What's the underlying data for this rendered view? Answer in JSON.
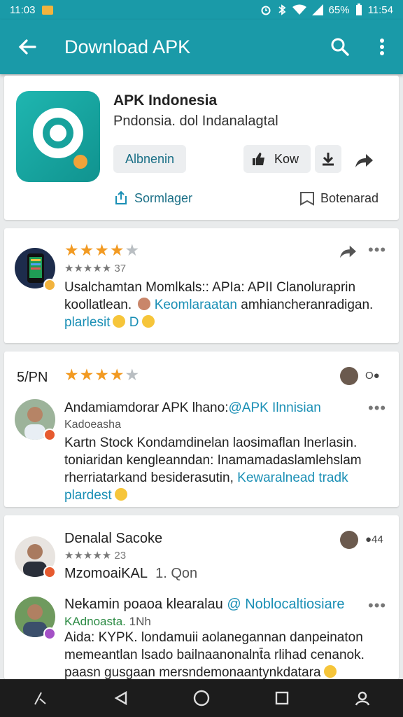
{
  "status_bar": {
    "time": "11:03",
    "battery": "65%",
    "time_right": "11:54",
    "icons": [
      "alarm-icon",
      "bluetooth-icon",
      "wifi-icon",
      "signal-icon",
      "battery-icon"
    ]
  },
  "app_bar": {
    "title": "Download APK",
    "color": "#1a9aa8"
  },
  "app_card": {
    "name": "APK Indonesia",
    "subtitle": "Pndonsia. dol Indanalagtal",
    "primary_button": "Albnenin",
    "like_button": "Kow",
    "left_link": "Sormlager",
    "right_link": "Botenarad"
  },
  "reviews": [
    {
      "stars": 4,
      "date": "★★★★★ 37",
      "text_line1": "Usalchamtan Momlkals:: APIa: APII Clanoluraprin",
      "text_line2_a": "koollatlean.",
      "text_line2_b": "Keomlaraatan",
      "text_line2_c": "amhiancheranradigan.",
      "text_line3": "plarlesit",
      "text_line3_b": "D"
    },
    {
      "header_label": "5/PN",
      "stars": 4,
      "author": "Andamiamdorar APK lhano:",
      "mention": "@APK Ilnnisian",
      "sub": "Kadoeasha",
      "body_line1": "Kartn Stock Kondamdinelan laosimaflan lnerlasin.",
      "body_line2": "toniaridan kengleanndan: Inamamadaslamlehslam",
      "body_line3": "rherriatarkand besiderasutin,",
      "body_line3_link": "Kewaralnead tradk",
      "body_line4": "plardest",
      "corner_count": "O●"
    },
    {
      "author": "Denalal Sacoke",
      "date": "★★★★★ 23",
      "body": "Mzomoai",
      "body_bold": "KAL",
      "body_tail": "1. Qon",
      "corner_count": "●44"
    },
    {
      "author": "Nekamin poaoa klearalau",
      "mention": "@ Noblocaltiosiare",
      "sub": "KAdnoasta.",
      "sub_tail": "1Nh",
      "body_line1": "Aida: KYPK. londamuii aolanegannan danpeinaton",
      "body_line2": "memeantlan lsado bailnaanonalnt̄a rlihad cenanok.",
      "body_line3": "paasn gusgaan mersndemonaantynkdatara"
    }
  ],
  "nav_bar": {
    "icons": [
      "pen-icon",
      "back-triangle-icon",
      "home-circle-icon",
      "recents-square-icon",
      "profile-icon"
    ]
  }
}
